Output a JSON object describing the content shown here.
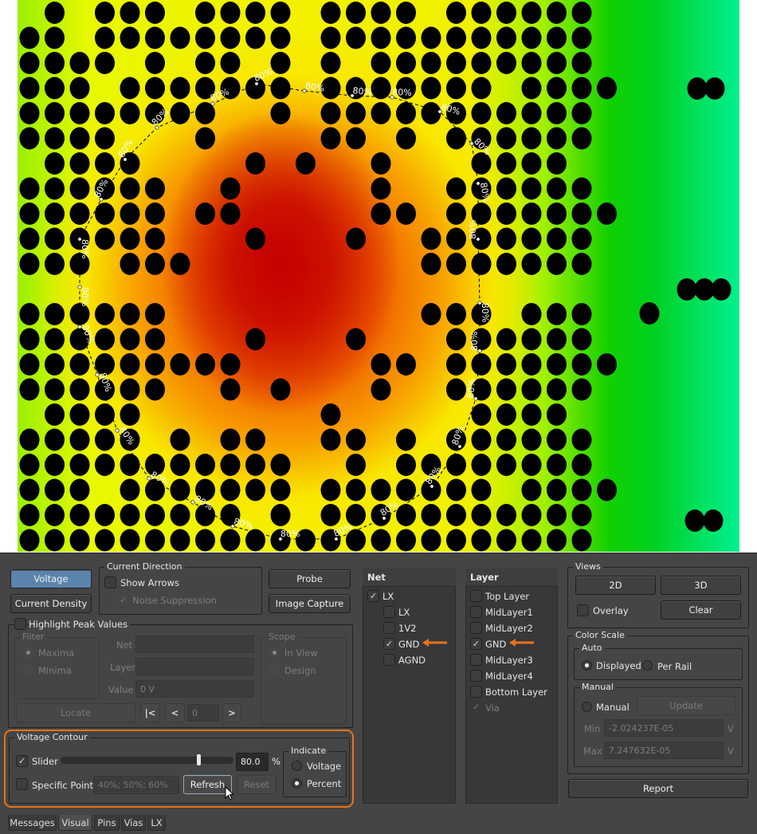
{
  "heatmap": {
    "contour_label": "80%"
  },
  "view_buttons": {
    "voltage": "Voltage",
    "current_density": "Current Density",
    "probe": "Probe",
    "image_capture": "Image Capture"
  },
  "current_direction": {
    "title": "Current Direction",
    "show_arrows": "Show Arrows",
    "noise_suppression": "Noise Suppression"
  },
  "highlight_peak": {
    "title": "Highlight Peak Values",
    "filter_title": "Filter",
    "maxima": "Maxima",
    "minima": "Minima",
    "net_label": "Net",
    "layer_label": "Layer",
    "value_label": "Value",
    "net_value": "",
    "layer_value": "",
    "value_value": "0 V",
    "scope_title": "Scope",
    "in_view": "In View",
    "design": "Design",
    "locate": "Locate",
    "nav_first": "|<",
    "nav_prev": "<",
    "nav_index": "0",
    "nav_next": ">"
  },
  "voltage_contour": {
    "title": "Voltage Contour",
    "slider_label": "Slider",
    "slider_percent": 80.0,
    "slider_value": "80.0",
    "percent_sign": "%",
    "specific_points_label": "Specific Points",
    "specific_points_placeholder": "40%; 50%; 60%",
    "refresh": "Refresh",
    "reset": "Reset",
    "indicate_title": "Indicate",
    "indicate_voltage": "Voltage",
    "indicate_percent": "Percent"
  },
  "net": {
    "header": "Net",
    "items": [
      {
        "label": "LX",
        "checked": true
      },
      {
        "label": "LX",
        "checked": false
      },
      {
        "label": "1V2",
        "checked": false
      },
      {
        "label": "GND",
        "checked": true
      },
      {
        "label": "AGND",
        "checked": false
      }
    ]
  },
  "layer": {
    "header": "Layer",
    "items": [
      {
        "label": "Top Layer",
        "checked": false
      },
      {
        "label": "MidLayer1",
        "checked": false
      },
      {
        "label": "MidLayer2",
        "checked": false
      },
      {
        "label": "GND",
        "checked": true
      },
      {
        "label": "MidLayer3",
        "checked": false
      },
      {
        "label": "MidLayer4",
        "checked": false
      },
      {
        "label": "Bottom Layer",
        "checked": false
      },
      {
        "label": "Via",
        "checked": true
      }
    ]
  },
  "views": {
    "title": "Views",
    "b2d": "2D",
    "b3d": "3D",
    "overlay": "Overlay",
    "clear": "Clear"
  },
  "color_scale": {
    "title": "Color Scale",
    "auto_title": "Auto",
    "displayed": "Displayed",
    "per_rail": "Per Rail",
    "manual_title": "Manual",
    "manual": "Manual",
    "update": "Update",
    "min_label": "Min",
    "min_value": "-2.024237E-05",
    "max_label": "Max",
    "max_value": "7.247632E-05",
    "unit": "V"
  },
  "report": "Report",
  "tabs": [
    "Messages",
    "Visual",
    "Pins",
    "Vias",
    "LX"
  ],
  "colors": {
    "accent_orange": "#e8731a",
    "active_button": "#5b84ad"
  }
}
